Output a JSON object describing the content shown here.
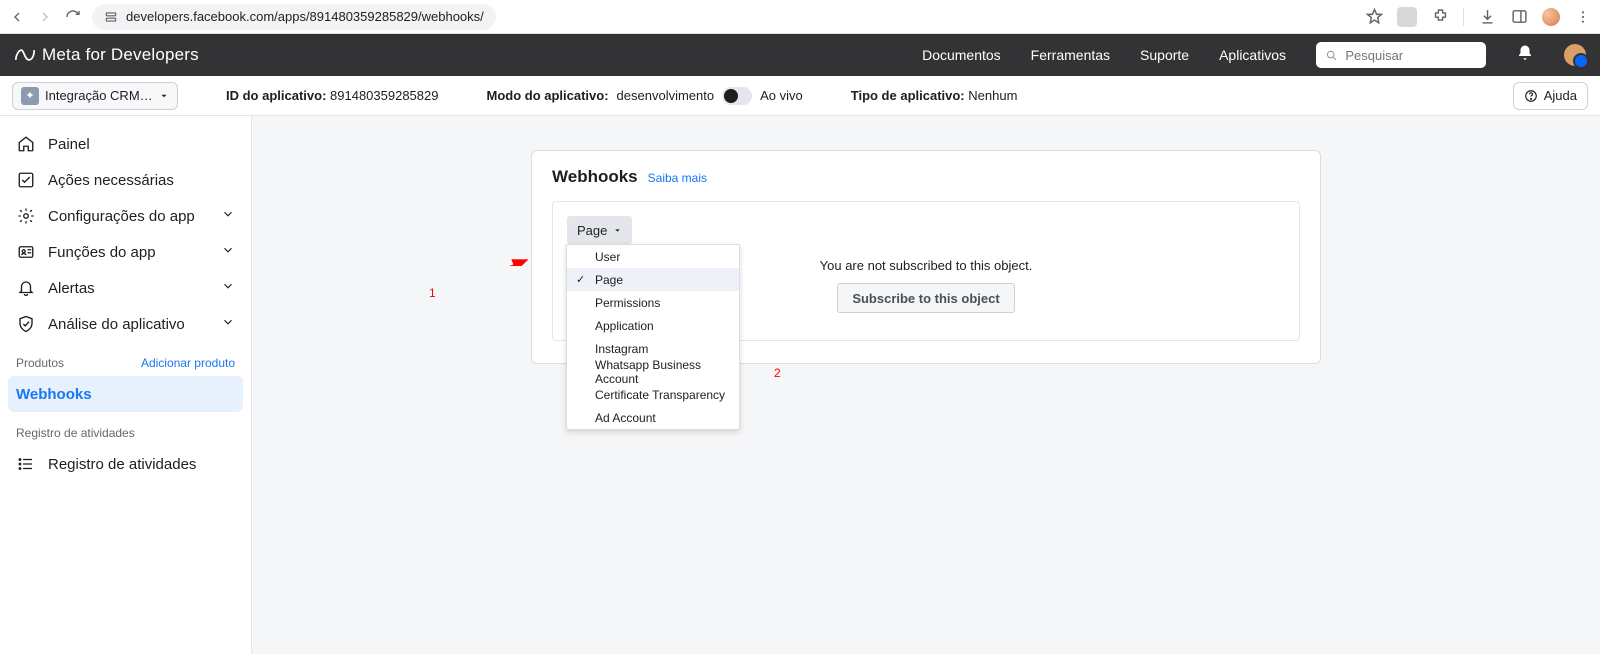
{
  "browser": {
    "url": "developers.facebook.com/apps/891480359285829/webhooks/"
  },
  "topbar": {
    "brand": "Meta for Developers",
    "nav": {
      "docs": "Documentos",
      "tools": "Ferramentas",
      "support": "Suporte",
      "apps": "Aplicativos"
    },
    "search_placeholder": "Pesquisar"
  },
  "infobar": {
    "app_name": "Integração CRM Edu...",
    "app_id_label": "ID do aplicativo:",
    "app_id_value": "891480359285829",
    "mode_label": "Modo do aplicativo:",
    "mode_value": "desenvolvimento",
    "mode_live": "Ao vivo",
    "type_label": "Tipo de aplicativo:",
    "type_value": "Nenhum",
    "help": "Ajuda"
  },
  "sidebar": {
    "painel": "Painel",
    "acoes": "Ações necessárias",
    "config": "Configurações do app",
    "funcoes": "Funções do app",
    "alertas": "Alertas",
    "analise": "Análise do aplicativo",
    "produtos_label": "Produtos",
    "adicionar": "Adicionar produto",
    "webhooks": "Webhooks",
    "registro_label": "Registro de atividades",
    "registro": "Registro de atividades"
  },
  "card": {
    "title": "Webhooks",
    "learn_more": "Saiba mais",
    "selector_label": "Page",
    "options": [
      "User",
      "Page",
      "Permissions",
      "Application",
      "Instagram",
      "Whatsapp Business Account",
      "Certificate Transparency",
      "Ad Account"
    ],
    "selected_index": 1,
    "not_subscribed": "You are not subscribed to this object.",
    "subscribe_btn": "Subscribe to this object"
  },
  "annotations": {
    "one": "1",
    "two": "2"
  }
}
